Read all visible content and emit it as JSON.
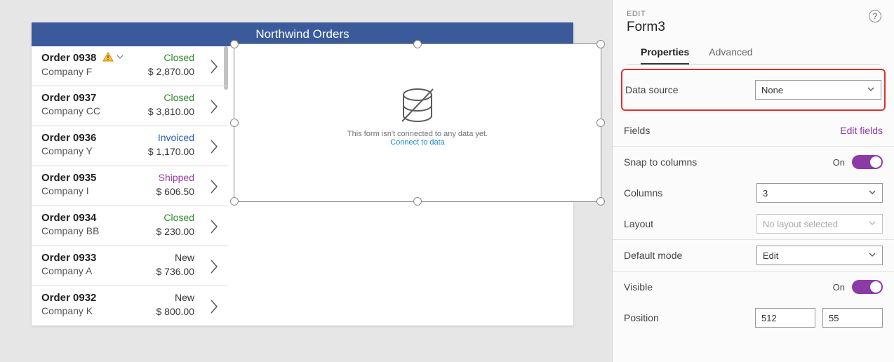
{
  "app": {
    "title": "Northwind Orders",
    "orders": [
      {
        "id": "Order 0938",
        "company": "Company F",
        "status": "Closed",
        "status_color": "#2e8b2e",
        "price": "$ 2,870.00",
        "warn": true
      },
      {
        "id": "Order 0937",
        "company": "Company CC",
        "status": "Closed",
        "status_color": "#2e8b2e",
        "price": "$ 3,810.00",
        "warn": false
      },
      {
        "id": "Order 0936",
        "company": "Company Y",
        "status": "Invoiced",
        "status_color": "#2a5cc4",
        "price": "$ 1,170.00",
        "warn": false
      },
      {
        "id": "Order 0935",
        "company": "Company I",
        "status": "Shipped",
        "status_color": "#9a3aa6",
        "price": "$ 606.50",
        "warn": false
      },
      {
        "id": "Order 0934",
        "company": "Company BB",
        "status": "Closed",
        "status_color": "#2e8b2e",
        "price": "$ 230.00",
        "warn": false
      },
      {
        "id": "Order 0933",
        "company": "Company A",
        "status": "New",
        "status_color": "#333333",
        "price": "$ 736.00",
        "warn": false
      },
      {
        "id": "Order 0932",
        "company": "Company K",
        "status": "New",
        "status_color": "#333333",
        "price": "$ 800.00",
        "warn": false
      }
    ],
    "empty_form": {
      "line1": "This form isn't connected to any data yet.",
      "link": "Connect to data"
    }
  },
  "pane": {
    "edit_label": "EDIT",
    "form_name": "Form3",
    "tabs": {
      "properties": "Properties",
      "advanced": "Advanced"
    },
    "data_source": {
      "label": "Data source",
      "value": "None"
    },
    "fields": {
      "label": "Fields",
      "link": "Edit fields"
    },
    "snap": {
      "label": "Snap to columns",
      "state": "On"
    },
    "columns": {
      "label": "Columns",
      "value": "3"
    },
    "layout": {
      "label": "Layout",
      "value": "No layout selected"
    },
    "default_mode": {
      "label": "Default mode",
      "value": "Edit"
    },
    "visible": {
      "label": "Visible",
      "state": "On"
    },
    "position": {
      "label": "Position",
      "x": "512",
      "y": "55"
    }
  }
}
